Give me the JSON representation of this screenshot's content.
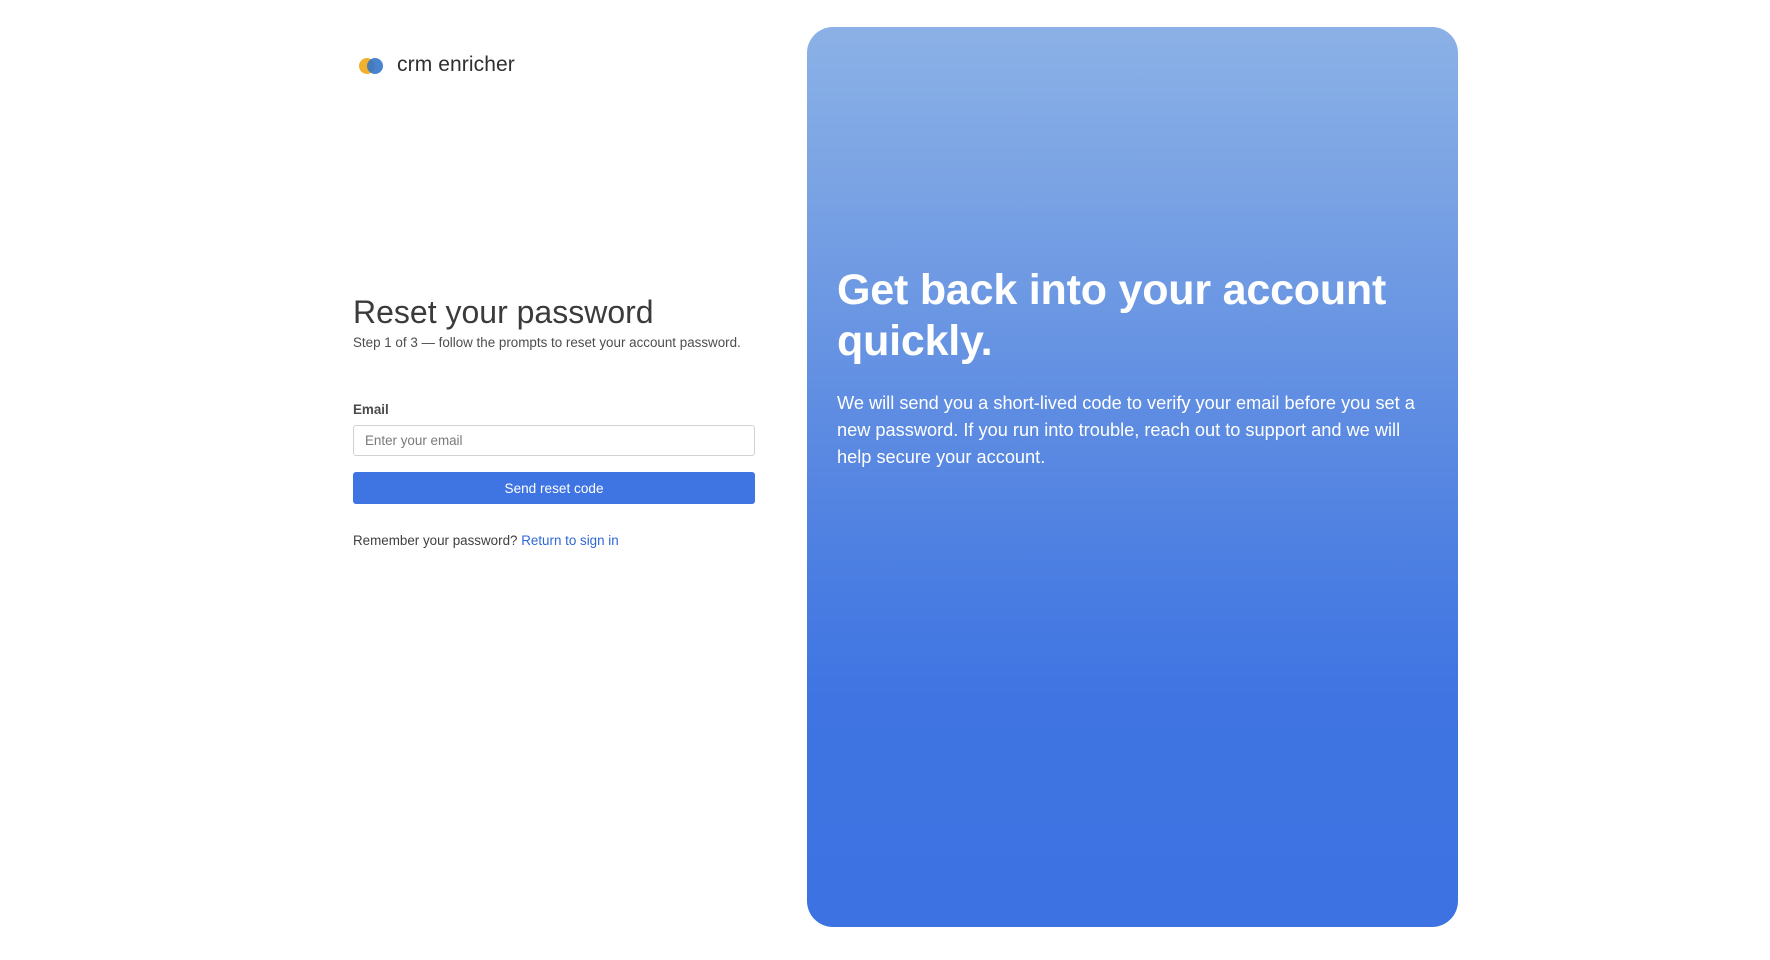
{
  "brand": {
    "name": "crm enricher",
    "logo_colors": [
      "#f2b02f",
      "#2f73c9"
    ]
  },
  "form": {
    "title": "Reset your password",
    "subtitle": "Step 1 of 3 — follow the prompts to reset your account password.",
    "email_label": "Email",
    "email_placeholder": "Enter your email",
    "email_value": "",
    "submit_label": "Send reset code",
    "footer_prompt": "Remember your password?",
    "footer_link": "Return to sign in"
  },
  "hero": {
    "title": "Get back into your account quickly.",
    "text": "We will send you a short-lived code to verify your email before you set a new password. If you run into trouble, reach out to support and we will help secure your account."
  },
  "colors": {
    "accent": "#3f74e3",
    "link": "#2f66d8",
    "hero_top": "#8bb1e6",
    "hero_bottom": "#3c72e2"
  }
}
